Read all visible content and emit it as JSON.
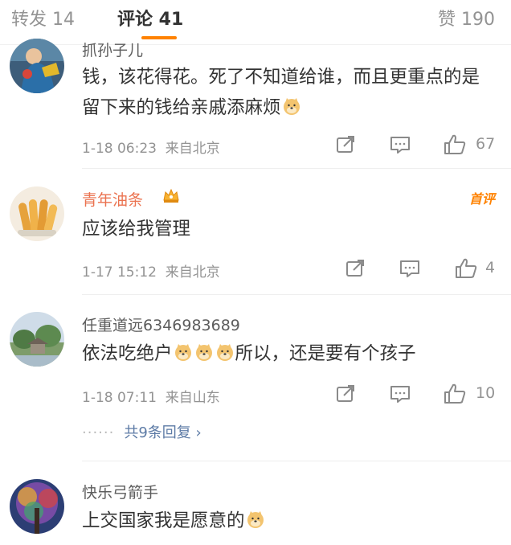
{
  "tabs": {
    "repost": "转发 14",
    "comments": "评论 41",
    "likes": "赞 190"
  },
  "comments": [
    {
      "user": "抓孙子儿",
      "text": "钱，该花得花。死了不知道给谁，而且更重点的是留下来的钱给亲戚添麻烦",
      "time": "1-18 06:23",
      "location": "来自北京",
      "likes": "67"
    },
    {
      "user": "青年油条",
      "badge": "首评",
      "text": "应该给我管理",
      "time": "1-17 15:12",
      "location": "来自北京",
      "likes": "4"
    },
    {
      "user": "任重道远6346983689",
      "text_before": "依法吃绝户",
      "text_after": "所以，还是要有个孩子",
      "time": "1-18 07:11",
      "location": "来自山东",
      "likes": "10",
      "replies": "共9条回复 ›"
    },
    {
      "user": "快乐弓箭手",
      "text": "上交国家我是愿意的"
    }
  ],
  "colors": {
    "accent": "#ff8200",
    "vip_name": "#eb7350",
    "link": "#5d7ba6",
    "muted": "#939393"
  },
  "icons": [
    "forward-icon",
    "comment-icon",
    "like-icon",
    "doge-emoji",
    "crown-icon"
  ]
}
